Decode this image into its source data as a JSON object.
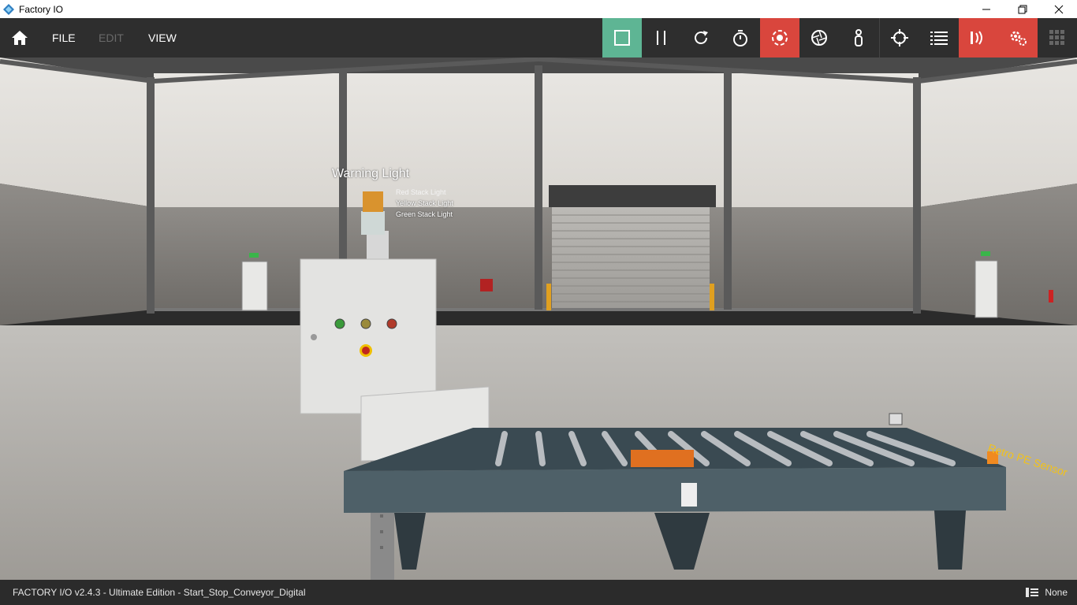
{
  "window": {
    "title": "Factory IO",
    "controls": [
      "minimize-icon",
      "restore-icon",
      "close-icon"
    ]
  },
  "menu": {
    "file": "FILE",
    "edit": "EDIT",
    "view": "VIEW"
  },
  "toolbar": {
    "buttons": [
      {
        "name": "stop-button",
        "icon": "stop-square-icon",
        "active": true,
        "color": "#5eb594"
      },
      {
        "name": "pause-button",
        "icon": "pause-icon"
      },
      {
        "name": "reset-button",
        "icon": "reset-icon"
      },
      {
        "name": "timer-button",
        "icon": "stopwatch-icon"
      },
      {
        "name": "camera-orbit-button",
        "icon": "orbit-camera-icon",
        "active": true,
        "color": "#d9463d"
      },
      {
        "name": "camera-fly-button",
        "icon": "aperture-icon"
      },
      {
        "name": "camera-first-person-button",
        "icon": "person-icon"
      },
      {
        "name": "target-button",
        "icon": "crosshair-icon"
      },
      {
        "name": "tag-list-button",
        "icon": "list-icon"
      },
      {
        "name": "sensor-button",
        "icon": "sensor-wave-icon",
        "active": true,
        "color": "#d9463d"
      },
      {
        "name": "drivers-button",
        "icon": "gears-icon",
        "active": true,
        "color": "#d9463d"
      },
      {
        "name": "palette-button",
        "icon": "grid-icon"
      }
    ]
  },
  "scene": {
    "warning_light_label": "Warning Light",
    "red_light_label": "Red Stack Light",
    "yellow_light_label": "Yellow Stack Light",
    "green_light_label": "Green Stack Light",
    "sensor_label": "Retro PE Sensor"
  },
  "status": {
    "text": "FACTORY I/O v2.4.3 - Ultimate Edition - Start_Stop_Conveyor_Digital",
    "driver": "None"
  }
}
